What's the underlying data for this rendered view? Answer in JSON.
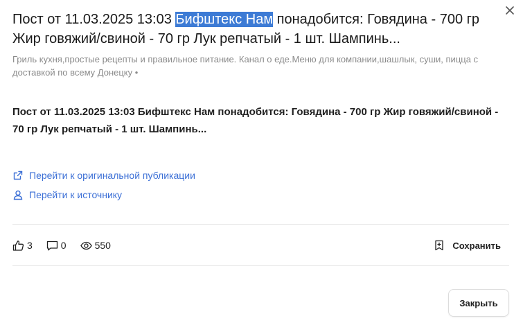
{
  "post": {
    "title_prefix": "Пост от 11.03.2025 13:03 ",
    "title_highlight": "Бифштекс Нам",
    "title_suffix": " понадобится: Говядина - 700 гр Жир говяжий/свиной - 70 гр Лук репчатый - 1 шт. Шампинь...",
    "subtitle": "Гриль кухня,простые рецепты и правильное питание. Канал о еде.Меню для компании,шашлык, суши, пицца с доставкой по всему Донецку •",
    "body": "Пост от 11.03.2025 13:03 Бифштекс Нам понадобится: Говядина - 700 гр Жир говяжий/свиной - 70 гр Лук репчатый - 1 шт. Шампинь..."
  },
  "links": {
    "original": "Перейти к оригинальной публикации",
    "source": "Перейти к источнику"
  },
  "stats": {
    "likes": "3",
    "comments": "0",
    "views": "550"
  },
  "actions": {
    "save": "Сохранить",
    "close": "Закрыть"
  },
  "colors": {
    "accent": "#3b6fd6",
    "highlight": "#3d7bd5",
    "muted": "#8a8a8a",
    "divider": "#e3e3e3"
  },
  "icons": {
    "close": "close-icon",
    "external_link": "external-link-icon",
    "user": "user-icon",
    "like": "thumbs-up-icon",
    "comment": "comment-icon",
    "views": "eye-icon",
    "save": "bookmark-icon"
  }
}
